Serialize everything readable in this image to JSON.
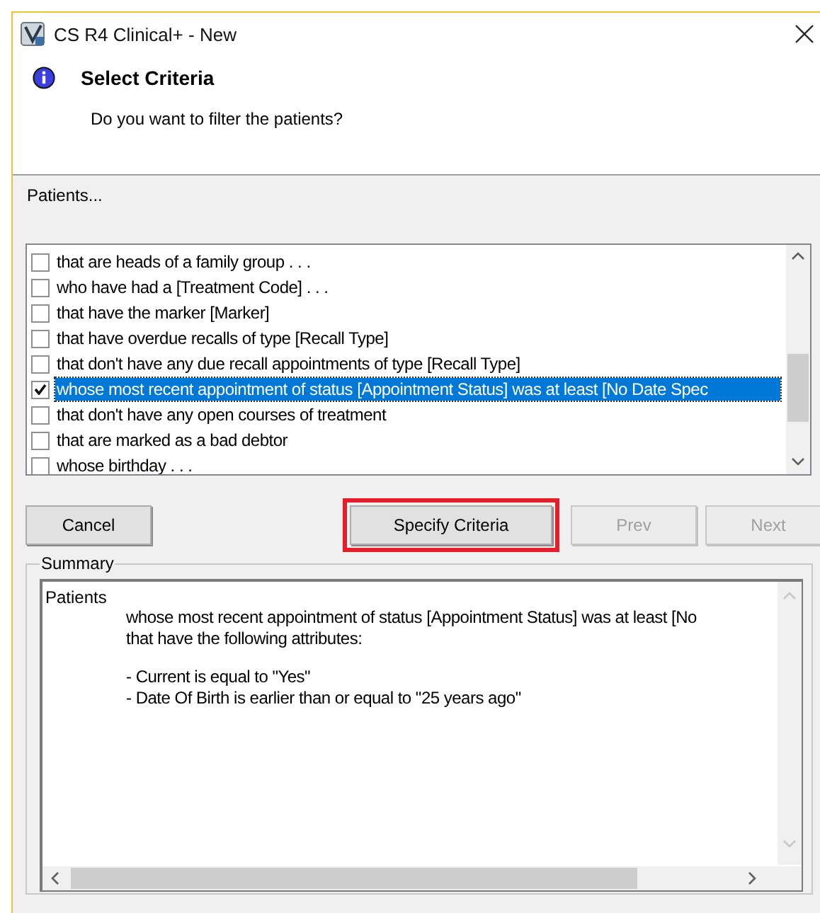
{
  "window": {
    "title": "CS R4 Clinical+ - New"
  },
  "header": {
    "title": "Select Criteria",
    "message": "Do you want to filter the patients?"
  },
  "section_label": "Patients...",
  "criteria": [
    {
      "label": "that are heads of a family group . . .",
      "checked": false,
      "selected": false
    },
    {
      "label": "who have had a [Treatment Code]  . . .",
      "checked": false,
      "selected": false
    },
    {
      "label": "that have the marker [Marker]",
      "checked": false,
      "selected": false
    },
    {
      "label": "that have overdue recalls of type [Recall Type]",
      "checked": false,
      "selected": false
    },
    {
      "label": "that don't have any due recall appointments of type [Recall Type]",
      "checked": false,
      "selected": false
    },
    {
      "label": "whose most recent appointment of status [Appointment Status] was at least [No Date Spec",
      "checked": true,
      "selected": true
    },
    {
      "label": "that don't have any open courses of treatment",
      "checked": false,
      "selected": false
    },
    {
      "label": "that are marked as a bad debtor",
      "checked": false,
      "selected": false
    },
    {
      "label": "whose birthday . . .",
      "checked": false,
      "selected": false
    }
  ],
  "buttons": [
    {
      "label": "Cancel",
      "kind": "left",
      "disabled": false,
      "highlighted": false
    },
    {
      "label": "Specify Criteria",
      "kind": "right",
      "disabled": false,
      "highlighted": true
    },
    {
      "label": "Prev",
      "kind": "right",
      "disabled": true,
      "highlighted": false
    },
    {
      "label": "Next",
      "kind": "right",
      "disabled": true,
      "highlighted": false
    }
  ],
  "summary": {
    "title": "Summary",
    "subject": "Patients",
    "paragraphs": [
      [
        "whose most recent appointment of status [Appointment Status] was at least [No",
        "that have the following attributes:"
      ],
      [
        "- Current is equal to \"Yes\"",
        "- Date Of Birth is earlier than or equal to \"25 years ago\""
      ]
    ]
  }
}
